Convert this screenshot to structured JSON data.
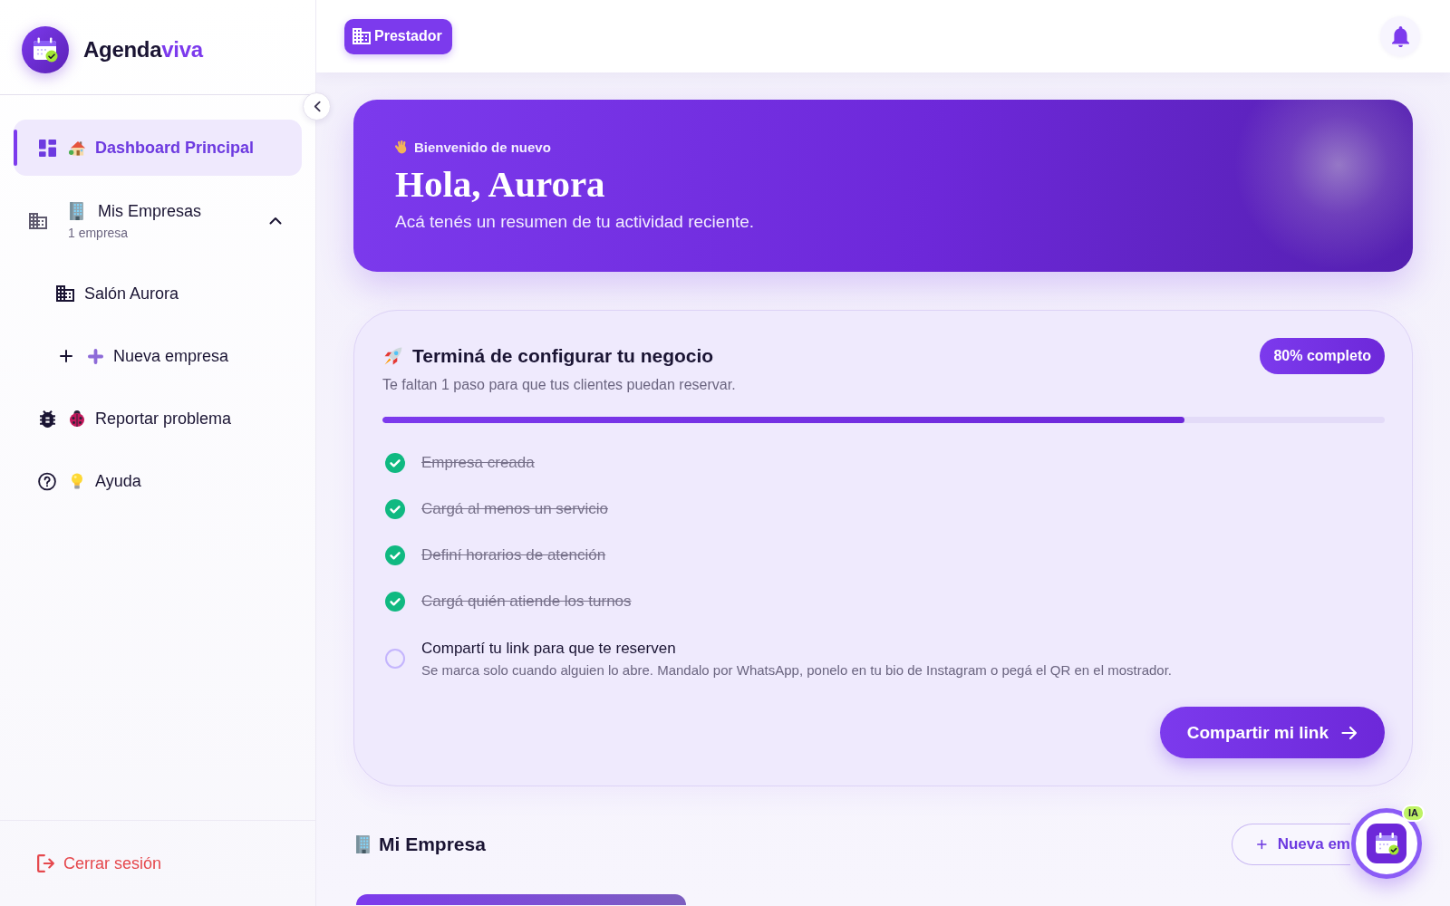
{
  "sidebar": {
    "brand": {
      "name_lead": "Agenda",
      "name_accent": "viva"
    },
    "items": [
      {
        "kind": "link",
        "label": "Dashboard Principal",
        "selected": true
      },
      {
        "kind": "group",
        "label": "Mis Empresas",
        "caption": "1 empresa",
        "selected": false,
        "expanded": true,
        "children": [
          {
            "kind": "company",
            "label": "Salón Aurora",
            "selected": false
          },
          {
            "kind": "add",
            "label": "Nueva empresa",
            "selected": false
          }
        ]
      },
      {
        "kind": "link",
        "label": "Reportar problema",
        "selected": false
      },
      {
        "kind": "link",
        "label": "Ayuda",
        "selected": false
      }
    ],
    "logout": "Cerrar sesión"
  },
  "top_bar": {
    "role_badge": "Prestador"
  },
  "welcome": {
    "eyebrow": "Bienvenido de nuevo",
    "title": "Hola, Aurora",
    "subtitle": "Acá tenés un resumen de tu actividad reciente."
  },
  "setup": {
    "title": "Terminá de configurar tu negocio",
    "badge": "80% completo",
    "subtitle": "Te faltan 1 paso para que tus clientes puedan reservar.",
    "progress": {
      "level": 0.8
    },
    "steps": [
      {
        "label": "Empresa creada",
        "checked": true
      },
      {
        "label": "Cargá al menos un servicio",
        "checked": true
      },
      {
        "label": "Definí horarios de atención",
        "checked": true
      },
      {
        "label": "Cargá quién atiende los turnos",
        "checked": true
      },
      {
        "label": "Compartí tu link para que te reserven",
        "description": "Se marca solo cuando alguien lo abre. Mandalo por WhatsApp, ponelo en tu bio de Instagram o pegá el QR en el mostrador.",
        "checked": false
      }
    ],
    "action": "Compartir mi link"
  },
  "company": {
    "title": "Mi Empresa",
    "new_button": "Nueva em"
  },
  "assistant": {
    "badge": "IA"
  }
}
